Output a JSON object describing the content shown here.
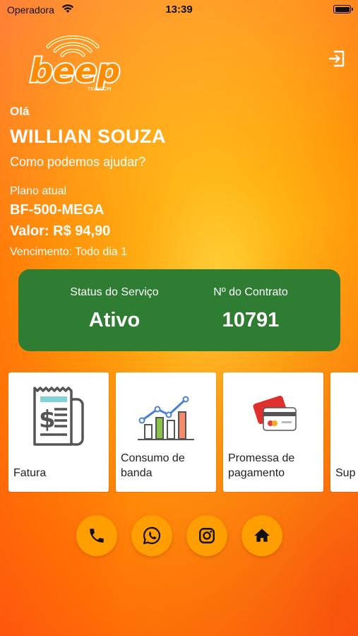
{
  "status_bar": {
    "carrier": "Operadora",
    "time": "13:39"
  },
  "header": {
    "logo_text": "beep",
    "logo_subtext": "TELECOM"
  },
  "greeting": {
    "hello": "Olá",
    "name": "WILLIAN SOUZA",
    "help": "Como podemos ajudar?"
  },
  "plan": {
    "label": "Plano atual",
    "name": "BF-500-MEGA",
    "value": "Valor: R$ 94,90",
    "due": "Vencimento: Todo dia 1"
  },
  "service": {
    "status_label": "Status do Serviço",
    "status_value": "Ativo",
    "contract_label": "Nº do Contrato",
    "contract_value": "10791",
    "color": "#2e7d32"
  },
  "tiles": [
    {
      "label": "Fatura",
      "icon": "invoice-icon"
    },
    {
      "label": "Consumo de\nbanda",
      "icon": "bandwidth-chart-icon"
    },
    {
      "label": "Promessa de\npagamento",
      "icon": "credit-card-icon"
    },
    {
      "label": "Sup",
      "icon": "support-icon"
    }
  ],
  "actions": [
    {
      "icon": "phone-icon"
    },
    {
      "icon": "whatsapp-icon"
    },
    {
      "icon": "instagram-icon"
    },
    {
      "icon": "home-icon"
    }
  ],
  "colors": {
    "accent": "#ff9e00",
    "status_green": "#2e7d32"
  }
}
